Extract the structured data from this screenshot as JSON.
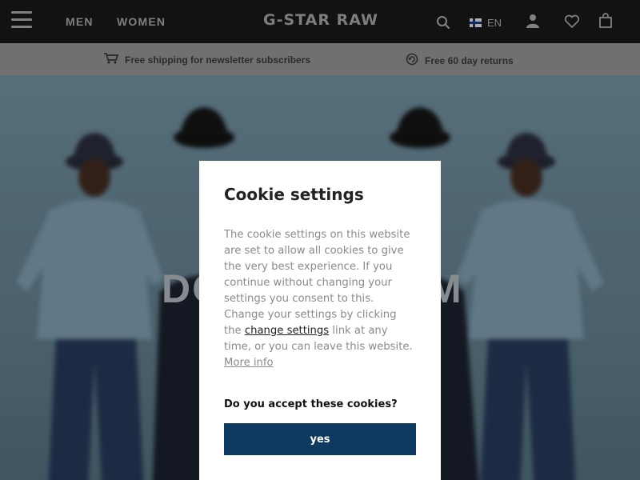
{
  "header": {
    "menu_icon": "hamburger-icon",
    "nav": [
      {
        "label": "MEN"
      },
      {
        "label": "WOMEN"
      }
    ],
    "logo": "G-STAR RAW",
    "search_icon": "search-icon",
    "language": {
      "flag_icon": "sweden-flag-icon",
      "label": "EN"
    },
    "account_icon": "user-icon",
    "wishlist_icon": "heart-icon",
    "bag_icon": "shopping-bag-icon"
  },
  "promo": {
    "items": [
      {
        "icon": "cart-icon",
        "text": "Free shipping for newsletter subscribers"
      },
      {
        "icon": "returns-icon",
        "text": "Free 60 day returns"
      }
    ]
  },
  "hero": {
    "headline_left": "DO",
    "headline_right": "M"
  },
  "cookie_modal": {
    "title": "Cookie settings",
    "body_part1": "The cookie settings on this website are set to allow all cookies to give the very best experience. If you continue without changing your settings you consent to this. Change your settings by clicking the ",
    "change_settings_link": "change settings",
    "body_part2": " link at any time, or you can leave this website.",
    "more_info_link": "More info",
    "question": "Do you accept these cookies?",
    "yes_button": "yes"
  },
  "colors": {
    "header_bg": "#1b1b1b",
    "promo_bg": "#a6a6a6",
    "button_bg": "#0d3a5e"
  }
}
